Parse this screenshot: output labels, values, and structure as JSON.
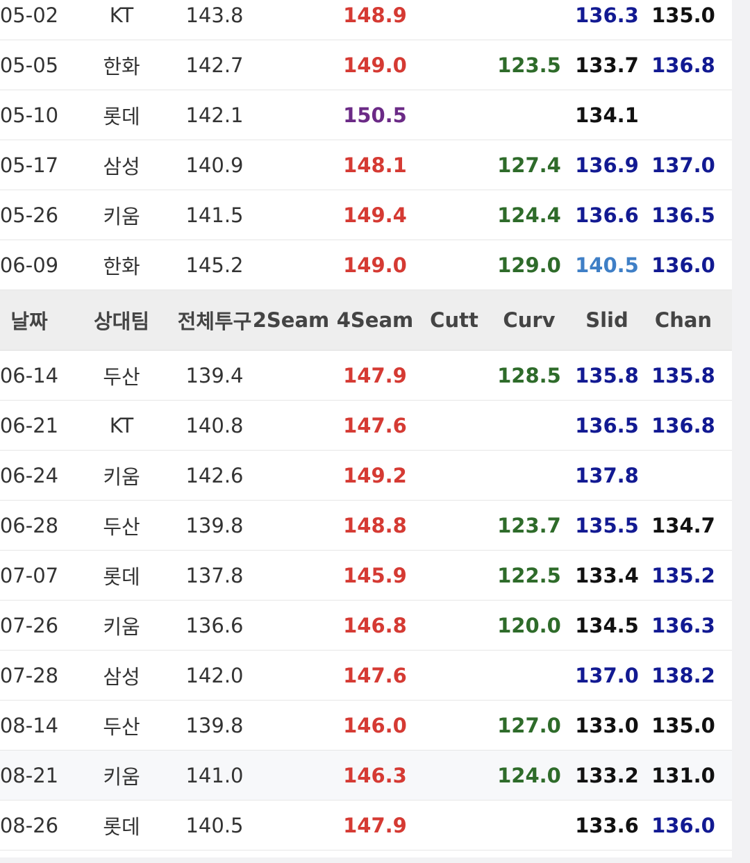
{
  "header": {
    "date": "날짜",
    "team": "상대팀",
    "total": "전체투구",
    "seam2": "2Seam",
    "seam4": "4Seam",
    "cutt": "Cutt",
    "curv": "Curv",
    "slid": "Slid",
    "chan": "Chan"
  },
  "colors": {
    "red": "#d53a33",
    "purple": "#6b2a86",
    "green": "#2e6b2a",
    "navy": "#121a92",
    "black": "#111111",
    "light_blue": "#3f7fc6"
  },
  "rows_top": [
    {
      "date": "05-02",
      "team": "KT",
      "total": "143.8",
      "seam4": "148.9",
      "seam4_color": "red",
      "curv": "",
      "slid": "136.3",
      "slid_color": "navy",
      "chan": "135.0",
      "chan_color": "black"
    },
    {
      "date": "05-05",
      "team": "한화",
      "total": "142.7",
      "seam4": "149.0",
      "seam4_color": "red",
      "curv": "123.5",
      "slid": "133.7",
      "slid_color": "black",
      "chan": "136.8",
      "chan_color": "navy"
    },
    {
      "date": "05-10",
      "team": "롯데",
      "total": "142.1",
      "seam4": "150.5",
      "seam4_color": "purple",
      "curv": "",
      "slid": "134.1",
      "slid_color": "black",
      "chan": "",
      "chan_color": "black"
    },
    {
      "date": "05-17",
      "team": "삼성",
      "total": "140.9",
      "seam4": "148.1",
      "seam4_color": "red",
      "curv": "127.4",
      "slid": "136.9",
      "slid_color": "navy",
      "chan": "137.0",
      "chan_color": "navy"
    },
    {
      "date": "05-26",
      "team": "키움",
      "total": "141.5",
      "seam4": "149.4",
      "seam4_color": "red",
      "curv": "124.4",
      "slid": "136.6",
      "slid_color": "navy",
      "chan": "136.5",
      "chan_color": "navy"
    },
    {
      "date": "06-09",
      "team": "한화",
      "total": "145.2",
      "seam4": "149.0",
      "seam4_color": "red",
      "curv": "129.0",
      "slid": "140.5",
      "slid_color": "light",
      "chan": "136.0",
      "chan_color": "navy"
    }
  ],
  "rows_bottom": [
    {
      "date": "06-14",
      "team": "두산",
      "total": "139.4",
      "seam4": "147.9",
      "seam4_color": "red",
      "curv": "128.5",
      "slid": "135.8",
      "slid_color": "navy",
      "chan": "135.8",
      "chan_color": "navy"
    },
    {
      "date": "06-21",
      "team": "KT",
      "total": "140.8",
      "seam4": "147.6",
      "seam4_color": "red",
      "curv": "",
      "slid": "136.5",
      "slid_color": "navy",
      "chan": "136.8",
      "chan_color": "navy"
    },
    {
      "date": "06-24",
      "team": "키움",
      "total": "142.6",
      "seam4": "149.2",
      "seam4_color": "red",
      "curv": "",
      "slid": "137.8",
      "slid_color": "navy",
      "chan": "",
      "chan_color": "black"
    },
    {
      "date": "06-28",
      "team": "두산",
      "total": "139.8",
      "seam4": "148.8",
      "seam4_color": "red",
      "curv": "123.7",
      "slid": "135.5",
      "slid_color": "navy",
      "chan": "134.7",
      "chan_color": "black"
    },
    {
      "date": "07-07",
      "team": "롯데",
      "total": "137.8",
      "seam4": "145.9",
      "seam4_color": "red",
      "curv": "122.5",
      "slid": "133.4",
      "slid_color": "black",
      "chan": "135.2",
      "chan_color": "navy"
    },
    {
      "date": "07-26",
      "team": "키움",
      "total": "136.6",
      "seam4": "146.8",
      "seam4_color": "red",
      "curv": "120.0",
      "slid": "134.5",
      "slid_color": "black",
      "chan": "136.3",
      "chan_color": "navy"
    },
    {
      "date": "07-28",
      "team": "삼성",
      "total": "142.0",
      "seam4": "147.6",
      "seam4_color": "red",
      "curv": "",
      "slid": "137.0",
      "slid_color": "navy",
      "chan": "138.2",
      "chan_color": "navy"
    },
    {
      "date": "08-14",
      "team": "두산",
      "total": "139.8",
      "seam4": "146.0",
      "seam4_color": "red",
      "curv": "127.0",
      "slid": "133.0",
      "slid_color": "black",
      "chan": "135.0",
      "chan_color": "black"
    },
    {
      "date": "08-21",
      "team": "키움",
      "total": "141.0",
      "seam4": "146.3",
      "seam4_color": "red",
      "curv": "124.0",
      "slid": "133.2",
      "slid_color": "black",
      "chan": "131.0",
      "chan_color": "black"
    },
    {
      "date": "08-26",
      "team": "롯데",
      "total": "140.5",
      "seam4": "147.9",
      "seam4_color": "red",
      "curv": "",
      "slid": "133.6",
      "slid_color": "black",
      "chan": "136.0",
      "chan_color": "navy"
    }
  ]
}
